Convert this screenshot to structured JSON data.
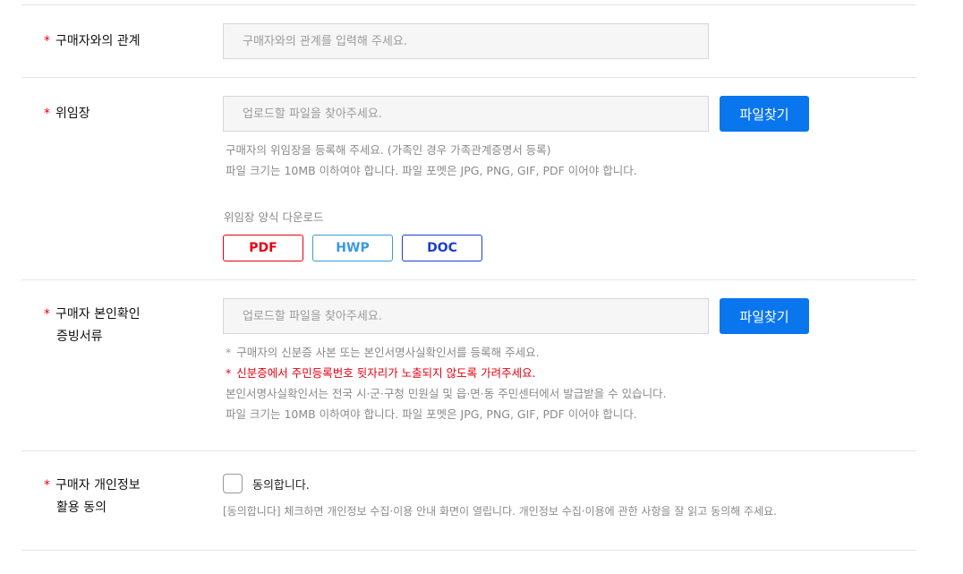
{
  "relationship": {
    "label": "구매자와의 관계",
    "placeholder": "구매자와의 관계를 입력해 주세요."
  },
  "proxy": {
    "label": "위임장",
    "placeholder": "업로드할 파일을 찾아주세요.",
    "button": "파일찾기",
    "help_lines": [
      "구매자의 위임장을 등록해 주세요. (가족인 경우 가족관계증명서 등록)",
      "파일 크기는 10MB 이하여야 합니다. 파일 포멧은 JPG, PNG, GIF, PDF 이어야 합니다."
    ],
    "download_title": "위임장 양식 다운로드",
    "downloads": [
      {
        "label": "PDF",
        "color": "#e60012"
      },
      {
        "label": "HWP",
        "color": "#3a9ae0"
      },
      {
        "label": "DOC",
        "color": "#1f3ec9"
      }
    ]
  },
  "identity": {
    "label_line1": "구매자 본인확인",
    "label_line2": "증빙서류",
    "placeholder": "업로드할 파일을 찾아주세요.",
    "button": "파일찾기",
    "help_line1": "구매자의 신분증 사본 또는 본인서명사실확인서를 등록해 주세요.",
    "help_line2": "신분증에서 주민등록번호 뒷자리가 노출되지 않도록 가려주세요.",
    "help_line3": "본인서명사실확인서는 전국 시·군·구청 민원실 및 읍·면·동 주민센터에서 발급받을 수 있습니다.",
    "help_line4": "파일 크기는 10MB 이하여야 합니다. 파일 포멧은 JPG, PNG, GIF, PDF 이어야 합니다."
  },
  "privacy": {
    "label_line1": "구매자 개인정보",
    "label_line2": "활용 동의",
    "agree_label": "동의합니다.",
    "note": "[동의합니다] 체크하면 개인정보 수집·이용 안내 화면이 열립니다. 개인정보 수집·이용에 관한 사항을 잘 읽고 동의해 주세요."
  },
  "required_mark": "*"
}
